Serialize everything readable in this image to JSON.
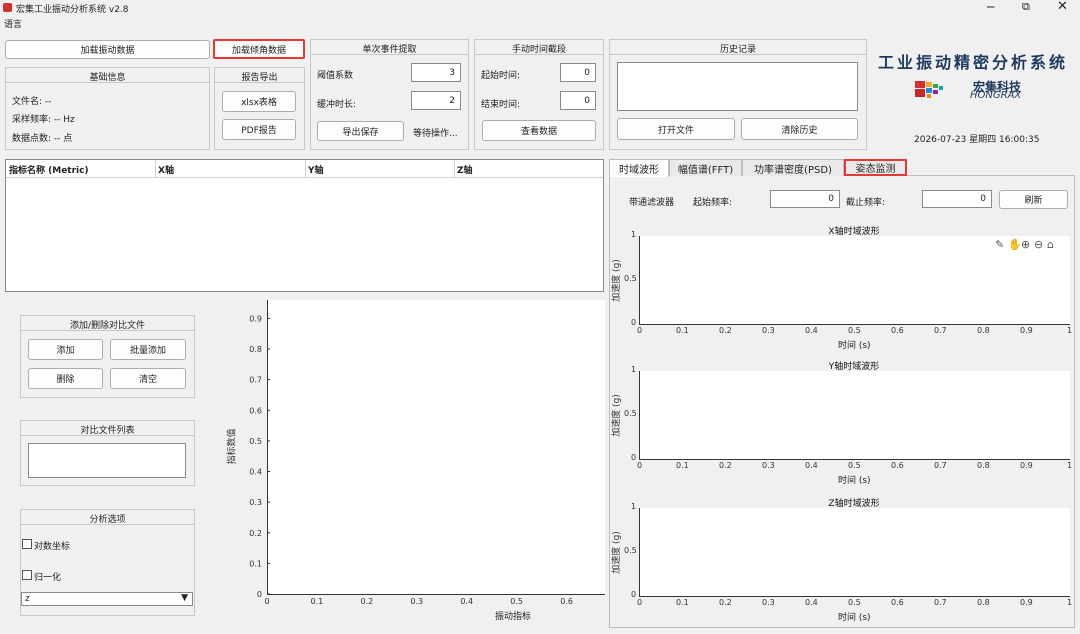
{
  "window": {
    "title": "宏集工业振动分析系统 v2.8",
    "menu": "语言"
  },
  "top": {
    "load_vibration": "加载振动数据",
    "load_tilt": "加载倾角数据",
    "basic_info": {
      "title": "基础信息",
      "filename": "文件名: --",
      "sample_rate": "采样频率: -- Hz",
      "points": "数据点数: -- 点"
    },
    "report": {
      "title": "报告导出",
      "xlsx": "xlsx表格",
      "pdf": "PDF报告"
    },
    "single_event": {
      "title": "单次事件提取",
      "threshold_label": "阈值系数",
      "threshold_value": "3",
      "buffer_label": "缓冲时长:",
      "buffer_value": "2",
      "export_save": "导出保存",
      "status": "等待操作..."
    },
    "manual": {
      "title": "手动时间截段",
      "start_label": "起始时间:",
      "start_value": "0",
      "end_label": "结束时间:",
      "end_value": "0",
      "view": "查看数据"
    },
    "history": {
      "title": "历史记录",
      "open": "打开文件",
      "clear": "清除历史"
    },
    "brand": {
      "title": "工业振动精密分析系统",
      "cn": "宏集科技",
      "en": "HONGRAX",
      "datetime": "2026-07-23 星期四 16:00:35"
    }
  },
  "table": {
    "headers": [
      "指标名称 (Metric)",
      "X轴",
      "Y轴",
      "Z轴"
    ]
  },
  "compare": {
    "title": "添加/删除对比文件",
    "add": "添加",
    "batch_add": "批量添加",
    "delete": "删除",
    "clear": "清空",
    "list_title": "对比文件列表"
  },
  "options": {
    "title": "分析选项",
    "log": "对数坐标",
    "normalize": "归一化",
    "axis_select": "z"
  },
  "main_plot": {
    "ylabel": "指标数值",
    "xlabel": "振动指标",
    "yticks": [
      "0",
      "0.1",
      "0.2",
      "0.3",
      "0.4",
      "0.5",
      "0.6",
      "0.7",
      "0.8",
      "0.9"
    ],
    "xticks": [
      "0",
      "0.1",
      "0.2",
      "0.3",
      "0.4",
      "0.5",
      "0.6"
    ]
  },
  "tabs": [
    "时域波形",
    "幅值谱(FFT)",
    "功率谱密度(PSD)",
    "姿态监测"
  ],
  "filter": {
    "label": "带通滤波器",
    "start_label": "起始频率:",
    "start_value": "0",
    "end_label": "截止频率:",
    "end_value": "0",
    "refresh": "刷新"
  },
  "waves": [
    {
      "title": "X轴时域波形",
      "ylabel": "加速度 (g)",
      "xlabel": "时间 (s)"
    },
    {
      "title": "Y轴时域波形",
      "ylabel": "加速度 (g)",
      "xlabel": "时间 (s)"
    },
    {
      "title": "Z轴时域波形",
      "ylabel": "加速度 (g)",
      "xlabel": "时间 (s)"
    }
  ],
  "wave_axis": {
    "yticks": [
      "0",
      "0.5",
      "1"
    ],
    "xticks": [
      "0",
      "0.1",
      "0.2",
      "0.3",
      "0.4",
      "0.5",
      "0.6",
      "0.7",
      "0.8",
      "0.9",
      "1"
    ]
  },
  "colors": {
    "accent_red": "#e53935",
    "brand_title": "#1f3a5f"
  }
}
